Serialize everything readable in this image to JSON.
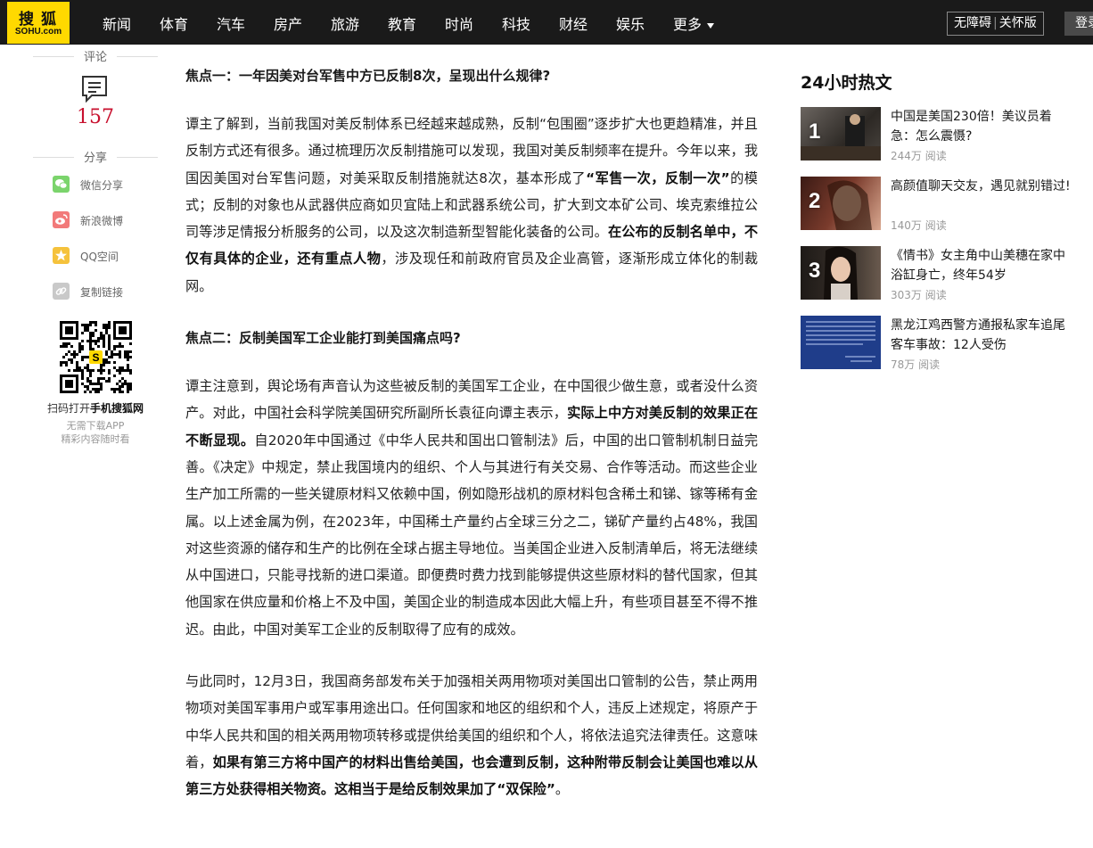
{
  "logo": {
    "cn": "搜狐",
    "en": "SOHU.com"
  },
  "nav": {
    "items": [
      "新闻",
      "体育",
      "汽车",
      "房产",
      "旅游",
      "教育",
      "时尚",
      "科技",
      "财经",
      "娱乐"
    ],
    "more": "更多",
    "accessibility": "无障碍",
    "elderly": "关怀版",
    "login": "登录"
  },
  "sidebar": {
    "comment_label": "评论",
    "comment_count": "157",
    "share_label": "分享",
    "share_items": [
      {
        "label": "微信分享",
        "icon": "wechat-icon",
        "color": "#7bd46c"
      },
      {
        "label": "新浪微博",
        "icon": "weibo-icon",
        "color": "#f27a7a"
      },
      {
        "label": "QQ空间",
        "icon": "qzone-icon",
        "color": "#f5c23c"
      },
      {
        "label": "复制链接",
        "icon": "link-icon",
        "color": "#c9c9c9"
      }
    ],
    "qr_caption_prefix": "扫码打开",
    "qr_caption_bold": "手机搜狐网",
    "qr_sub1": "无需下载APP",
    "qr_sub2": "精彩内容随时看"
  },
  "article": {
    "focus1_heading": "焦点一：一年因美对台军售中方已反制8次，呈现出什么规律?",
    "focus1_p1_a": "谭主了解到，当前我国对美反制体系已经越来越成熟，反制“包围圈”逐步扩大也更趋精准，并且反制方式还有很多。通过梳理历次反制措施可以发现，我国对美反制频率在提升。今年以来，我国因美国对台军售问题，对美采取反制措施就达8次，基本形成了",
    "focus1_p1_b": "“军售一次，反制一次”",
    "focus1_p1_c": "的模式；反制的对象也从武器供应商如贝宜陆上和武器系统公司，扩大到文本矿公司、埃克索维拉公司等涉足情报分析服务的公司，以及这次制造新型智能化装备的公司。",
    "focus1_p1_d": "在公布的反制名单中，不仅有具体的企业，还有重点人物",
    "focus1_p1_e": "，涉及现任和前政府官员及企业高管，逐渐形成立体化的制裁网。",
    "focus2_heading": "焦点二：反制美国军工企业能打到美国痛点吗?",
    "focus2_p1_a": "谭主注意到，舆论场有声音认为这些被反制的美国军工企业，在中国很少做生意，或者没什么资产。对此，中国社会科学院美国研究所副所长袁征向谭主表示，",
    "focus2_p1_b": "实际上中方对美反制的效果正在不断显现。",
    "focus2_p1_c": "自2020年中国通过《中华人民共和国出口管制法》后，中国的出口管制机制日益完善。《决定》中规定，禁止我国境内的组织、个人与其进行有关交易、合作等活动。而这些企业生产加工所需的一些关键原材料又依赖中国，例如隐形战机的原材料包含稀土和锑、镓等稀有金属。以上述金属为例，在2023年，中国稀土产量约占全球三分之二，锑矿产量约占48%，我国对这些资源的储存和生产的比例在全球占据主导地位。当美国企业进入反制清单后，将无法继续从中国进口，只能寻找新的进口渠道。即便费时费力找到能够提供这些原材料的替代国家，但其他国家在供应量和价格上不及中国，美国企业的制造成本因此大幅上升，有些项目甚至不得不推迟。由此，中国对美军工企业的反制取得了应有的成效。",
    "focus2_p2_a": "与此同时，12月3日，我国商务部发布关于加强相关两用物项对美国出口管制的公告，禁止两用物项对美国军事用户或军事用途出口。任何国家和地区的组织和个人，违反上述规定，将原产于中华人民共和国的相关两用物项转移或提供给美国的组织和个人，将依法追究法律责任。这意味着，",
    "focus2_p2_b": "如果有第三方将中国产的材料出售给美国，也会遭到反制，这种附带反制会让美国也难以从第三方处获得相关物资。这相当于是给反制效果加了“双保险”",
    "focus2_p2_c": "。"
  },
  "hot": {
    "title": "24小时热文",
    "items": [
      {
        "rank": "1",
        "text": "中国是美国230倍！美议员着急：怎么震慑?",
        "reads": "244万 阅读",
        "thumb_color": "#3a3530"
      },
      {
        "rank": "2",
        "text": "高颜值聊天交友，遇见就别错过!",
        "reads": "140万 阅读",
        "thumb_color": "#5a2a22"
      },
      {
        "rank": "3",
        "text": "《情书》女主角中山美穗在家中浴缸身亡，终年54岁",
        "reads": "303万 阅读",
        "thumb_color": "#2a2420"
      },
      {
        "rank": "",
        "text": "黑龙江鸡西警方通报私家车追尾客车事故：12人受伤",
        "reads": "78万 阅读",
        "thumb_color": "#1f3d8a"
      }
    ]
  }
}
